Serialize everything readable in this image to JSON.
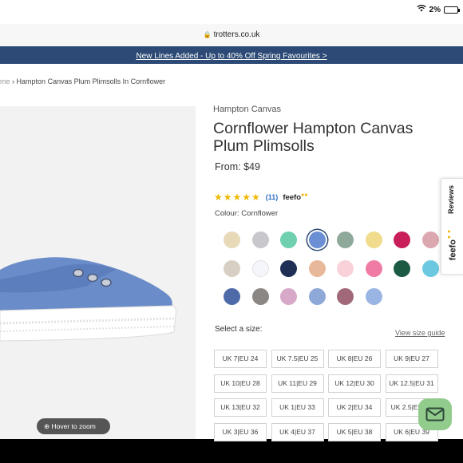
{
  "status": {
    "battery": "2%",
    "wifi_icon": "wifi-icon"
  },
  "browser": {
    "url": "trotters.co.uk",
    "lock_icon": "lock-icon"
  },
  "promo": {
    "text": "New Lines Added - Up to 40% Off Spring Favourites >"
  },
  "breadcrumb": {
    "home": "me",
    "separator": "›",
    "current": "Hampton Canvas Plum Plimsolls In Cornflower"
  },
  "image": {
    "zoom_label": "Hover to zoom",
    "zoom_icon": "zoom-icon"
  },
  "product": {
    "brand": "Hampton Canvas",
    "title": "Cornflower Hampton Canvas Plum Plimsolls",
    "price": "From: $49",
    "rating_stars": 5,
    "review_count": "(11)",
    "feefo": "feefo",
    "colour_label": "Colour: Cornflower"
  },
  "swatches": [
    {
      "color": "#e8d9b8",
      "selected": false
    },
    {
      "color": "#c8c8cc",
      "selected": false
    },
    {
      "color": "#6fd0b0",
      "selected": false
    },
    {
      "color": "#6b8fd4",
      "selected": true
    },
    {
      "color": "#8ea89a",
      "selected": false
    },
    {
      "color": "#f0dc8c",
      "selected": false
    },
    {
      "color": "#c81e5a",
      "selected": false
    },
    {
      "color": "#dca8b0",
      "selected": false
    },
    {
      "color": "#d8cfc4",
      "selected": false
    },
    {
      "color": "#f4f6fb",
      "selected": false
    },
    {
      "color": "#1f2f55",
      "selected": false
    },
    {
      "color": "#e8b89a",
      "selected": false
    },
    {
      "color": "#f8d2d8",
      "selected": false
    },
    {
      "color": "#f07ca6",
      "selected": false
    },
    {
      "color": "#1c5a44",
      "selected": false
    },
    {
      "color": "#6cc8e0",
      "selected": false
    },
    {
      "color": "#4e6aa8",
      "selected": false
    },
    {
      "color": "#8a8784",
      "selected": false
    },
    {
      "color": "#d8a8c8",
      "selected": false
    },
    {
      "color": "#8ea8d8",
      "selected": false
    },
    {
      "color": "#a06878",
      "selected": false
    },
    {
      "color": "#9ab4e4",
      "selected": false
    }
  ],
  "sizes": {
    "label": "Select a size:",
    "guide": "View size guide",
    "options": [
      "UK 7|EU 24",
      "UK 7.5|EU 25",
      "UK 8|EU 26",
      "UK 9|EU 27",
      "UK 10|EU 28",
      "UK 11|EU 29",
      "UK 12|EU 30",
      "UK 12.5|EU 31",
      "UK 13|EU 32",
      "UK 1|EU 33",
      "UK 2|EU 34",
      "UK 2.5|EU 35",
      "UK 3|EU 36",
      "UK 4|EU 37",
      "UK 5|EU 38",
      "UK 6|EU 39"
    ]
  },
  "reviews_tab": {
    "label": "Reviews",
    "logo": "feefo"
  },
  "chat": {
    "icon": "mail-icon"
  },
  "colors": {
    "promo_bg": "#2c4a75",
    "star": "#f0b800",
    "chat_bg": "#92cc8d",
    "link": "#2a6cc4"
  }
}
